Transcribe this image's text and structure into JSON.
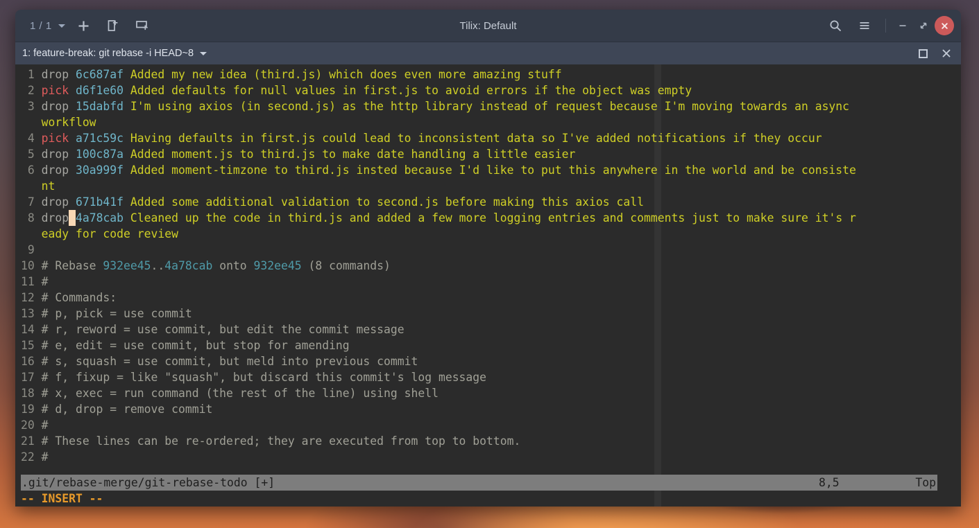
{
  "window": {
    "title": "Tilix: Default",
    "session_count": "1 / 1",
    "header_buttons": [
      {
        "name": "session-switcher",
        "label": "1 / 1"
      },
      {
        "name": "new-terminal-button",
        "label": "+"
      },
      {
        "name": "split-horizontal-button",
        "label": ""
      },
      {
        "name": "split-vertical-button",
        "label": ""
      }
    ],
    "header_right": [
      {
        "name": "search-button",
        "label": ""
      },
      {
        "name": "menu-button",
        "label": ""
      },
      {
        "name": "minimize-button",
        "label": "–"
      },
      {
        "name": "maximize-button",
        "label": ""
      },
      {
        "name": "close-button",
        "label": "×"
      }
    ]
  },
  "session": {
    "title": "1: feature-break: git rebase -i HEAD~8",
    "maximize_label": "",
    "close_label": "×"
  },
  "terminal": {
    "lines": [
      {
        "num": "1",
        "parts": [
          {
            "t": "cmd-drop",
            "s": "drop "
          },
          {
            "t": "hash",
            "s": "6c687af"
          },
          {
            "t": "msg",
            "s": " Added my new idea (third.js) which does even more amazing stuff"
          }
        ]
      },
      {
        "num": "2",
        "parts": [
          {
            "t": "cmd-pick",
            "s": "pick "
          },
          {
            "t": "hash",
            "s": "d6f1e60"
          },
          {
            "t": "msg",
            "s": " Added defaults for null values in first.js to avoid errors if the object was empty"
          }
        ]
      },
      {
        "num": "3",
        "parts": [
          {
            "t": "cmd-drop",
            "s": "drop "
          },
          {
            "t": "hash",
            "s": "15dabfd"
          },
          {
            "t": "msg",
            "s": " I'm using axios (in second.js) as the http library instead of request because I'm moving towards an async"
          }
        ]
      },
      {
        "num": "",
        "parts": [
          {
            "t": "msg",
            "s": "workflow"
          }
        ]
      },
      {
        "num": "4",
        "parts": [
          {
            "t": "cmd-pick",
            "s": "pick "
          },
          {
            "t": "hash",
            "s": "a71c59c"
          },
          {
            "t": "msg",
            "s": " Having defaults in first.js could lead to inconsistent data so I've added notifications if they occur"
          }
        ]
      },
      {
        "num": "5",
        "parts": [
          {
            "t": "cmd-drop",
            "s": "drop "
          },
          {
            "t": "hash",
            "s": "100c87a"
          },
          {
            "t": "msg",
            "s": " Added moment.js to third.js to make date handling a little easier"
          }
        ]
      },
      {
        "num": "6",
        "parts": [
          {
            "t": "cmd-drop",
            "s": "drop "
          },
          {
            "t": "hash",
            "s": "30a999f"
          },
          {
            "t": "msg",
            "s": " Added moment-timzone to third.js insted because I'd like to put this anywhere in the world and be consiste"
          }
        ]
      },
      {
        "num": "",
        "parts": [
          {
            "t": "msg",
            "s": "nt"
          }
        ]
      },
      {
        "num": "7",
        "parts": [
          {
            "t": "cmd-drop",
            "s": "drop "
          },
          {
            "t": "hash",
            "s": "671b41f"
          },
          {
            "t": "msg",
            "s": " Added some additional validation to second.js before making this axios call"
          }
        ]
      },
      {
        "num": "8",
        "parts": [
          {
            "t": "cmd-drop",
            "s": "drop"
          },
          {
            "t": "cursor",
            "s": " "
          },
          {
            "t": "hash",
            "s": "4a78cab"
          },
          {
            "t": "msg",
            "s": " Cleaned up the code in third.js and added a few more logging entries and comments just to make sure it's r"
          }
        ]
      },
      {
        "num": "",
        "parts": [
          {
            "t": "msg",
            "s": "eady for code review"
          }
        ]
      },
      {
        "num": "9",
        "parts": []
      },
      {
        "num": "10",
        "parts": [
          {
            "t": "cmt",
            "s": "# Rebase "
          },
          {
            "t": "cmt-hash",
            "s": "932ee45"
          },
          {
            "t": "cmt",
            "s": ".."
          },
          {
            "t": "cmt-hash",
            "s": "4a78cab"
          },
          {
            "t": "cmt",
            "s": " onto "
          },
          {
            "t": "cmt-hash",
            "s": "932ee45"
          },
          {
            "t": "cmt",
            "s": " (8 commands)"
          }
        ]
      },
      {
        "num": "11",
        "parts": [
          {
            "t": "cmt",
            "s": "#"
          }
        ]
      },
      {
        "num": "12",
        "parts": [
          {
            "t": "cmt",
            "s": "# Commands:"
          }
        ]
      },
      {
        "num": "13",
        "parts": [
          {
            "t": "cmt",
            "s": "# p, pick = use commit"
          }
        ]
      },
      {
        "num": "14",
        "parts": [
          {
            "t": "cmt",
            "s": "# r, reword = use commit, but edit the commit message"
          }
        ]
      },
      {
        "num": "15",
        "parts": [
          {
            "t": "cmt",
            "s": "# e, edit = use commit, but stop for amending"
          }
        ]
      },
      {
        "num": "16",
        "parts": [
          {
            "t": "cmt",
            "s": "# s, squash = use commit, but meld into previous commit"
          }
        ]
      },
      {
        "num": "17",
        "parts": [
          {
            "t": "cmt",
            "s": "# f, fixup = like \"squash\", but discard this commit's log message"
          }
        ]
      },
      {
        "num": "18",
        "parts": [
          {
            "t": "cmt",
            "s": "# x, exec = run command (the rest of the line) using shell"
          }
        ]
      },
      {
        "num": "19",
        "parts": [
          {
            "t": "cmt",
            "s": "# d, drop = remove commit"
          }
        ]
      },
      {
        "num": "20",
        "parts": [
          {
            "t": "cmt",
            "s": "#"
          }
        ]
      },
      {
        "num": "21",
        "parts": [
          {
            "t": "cmt",
            "s": "# These lines can be re-ordered; they are executed from top to bottom."
          }
        ]
      },
      {
        "num": "22",
        "parts": [
          {
            "t": "cmt",
            "s": "#"
          }
        ]
      }
    ]
  },
  "statusline": {
    "file": ".git/rebase-merge/git-rebase-todo [+]",
    "position": "8,5",
    "scroll": "Top"
  },
  "modeline": {
    "text": "-- INSERT --"
  },
  "colors": {
    "terminal_bg": "#2b2b2b",
    "headerbar_bg": "#343b48",
    "sessionbar_bg": "#3e4656",
    "pick": "#e05c5c",
    "drop": "#a5a5a0",
    "hash": "#6fb5c9",
    "message": "#cfcf26",
    "comment": "#a0a096",
    "cursor": "#f7d7b4",
    "statusline_bg": "#7d7d7d",
    "insert_mode": "#e89a2a",
    "close_button": "#cc5a5a"
  }
}
